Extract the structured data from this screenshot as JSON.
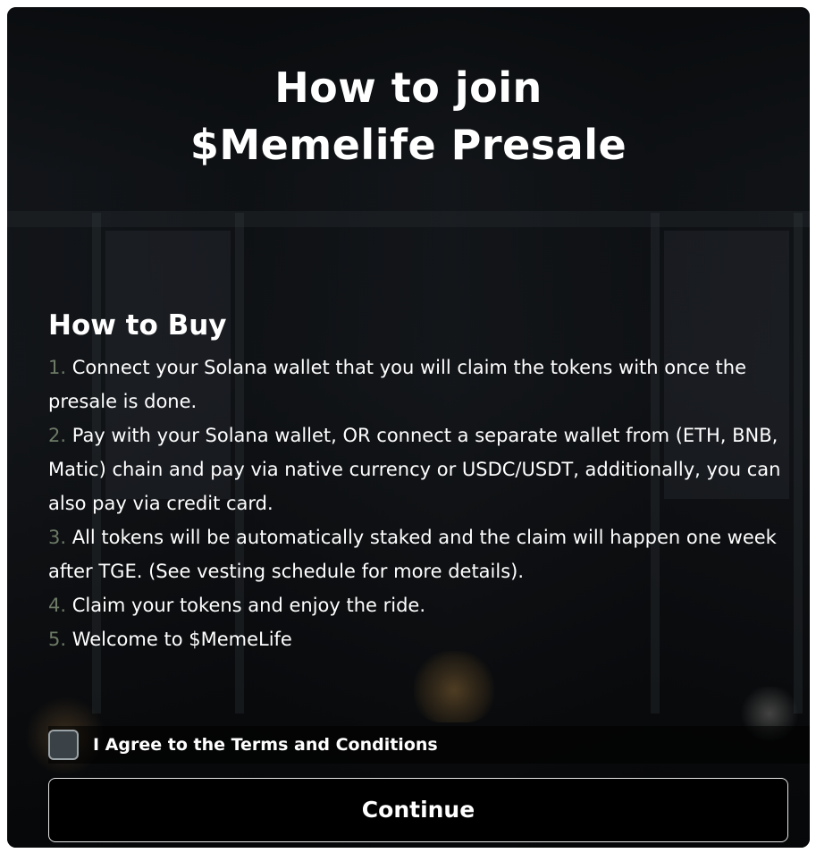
{
  "modal": {
    "title_line1": "How to join",
    "title_line2": "$Memelife Presale"
  },
  "how_to_buy": {
    "heading": "How to Buy",
    "steps": [
      {
        "num": "1.",
        "text": " Connect your Solana wallet that you will claim the tokens with once the presale is done."
      },
      {
        "num": "2.",
        "text": " Pay with your Solana wallet, OR connect a separate wallet from (ETH, BNB, Matic) chain and pay via native currency or USDC/USDT, additionally, you can also pay via credit card."
      },
      {
        "num": "3.",
        "text": " All tokens will be automatically staked and the claim will happen one week after TGE. (See vesting schedule for more details)."
      },
      {
        "num": "4.",
        "text": " Claim your tokens and enjoy the ride."
      },
      {
        "num": "5.",
        "text": " Welcome to $MemeLife"
      }
    ]
  },
  "terms": {
    "label": "I Agree to the Terms and Conditions",
    "checked": false
  },
  "continue_button": {
    "label": "Continue"
  },
  "colors": {
    "step_number": "#6c7a66",
    "text": "#ffffff",
    "button_bg": "#000000",
    "button_border": "#e6e6e6"
  }
}
